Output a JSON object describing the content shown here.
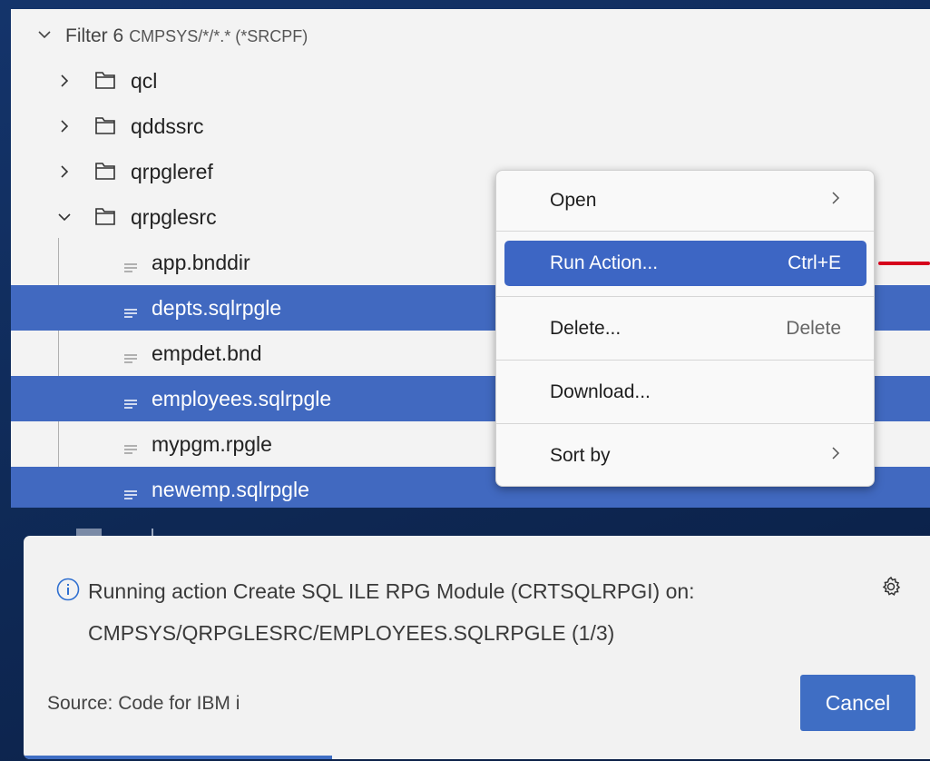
{
  "explorer": {
    "filter": {
      "label": "Filter 6",
      "path": "CMPSYS/*/*.* (*SRCPF)"
    },
    "folders": [
      {
        "name": "qcl",
        "expanded": false
      },
      {
        "name": "qddssrc",
        "expanded": false
      },
      {
        "name": "qrpgleref",
        "expanded": false
      },
      {
        "name": "qrpglesrc",
        "expanded": true
      }
    ],
    "files": [
      {
        "name": "app.bnddir",
        "selected": false
      },
      {
        "name": "depts.sqlrpgle",
        "selected": true
      },
      {
        "name": "empdet.bnd",
        "selected": false
      },
      {
        "name": "employees.sqlrpgle",
        "selected": true
      },
      {
        "name": "mypgm.rpgle",
        "selected": false
      },
      {
        "name": "newemp.sqlrpgle",
        "selected": true
      }
    ]
  },
  "context_menu": {
    "items": [
      {
        "label": "Open",
        "shortcut": "",
        "submenu": true
      },
      {
        "label": "Run Action...",
        "shortcut": "Ctrl+E",
        "active": true
      },
      {
        "label": "Delete...",
        "shortcut": "Delete"
      },
      {
        "label": "Download...",
        "shortcut": ""
      },
      {
        "label": "Sort by",
        "shortcut": "",
        "submenu": true
      }
    ]
  },
  "notification": {
    "message_line1": "Running action Create SQL ILE RPG Module (CRTSQLRPGI) on:",
    "message_line2": "CMPSYS/QRPGLESRC/EMPLOYEES.SQLRPGLE (1/3)",
    "source": "Source: Code for IBM i",
    "cancel_label": "Cancel",
    "progress": 0.34
  },
  "colors": {
    "selection": "#4169c0",
    "menu_active": "#3d66c4",
    "accent_button": "#3f6ec4",
    "arrow": "#d6001c"
  },
  "icons": {
    "chevron_right": "chevron-right-icon",
    "chevron_down": "chevron-down-icon",
    "folder": "folder-icon",
    "file": "file-lines-icon",
    "info": "info-icon",
    "gear": "gear-icon"
  }
}
